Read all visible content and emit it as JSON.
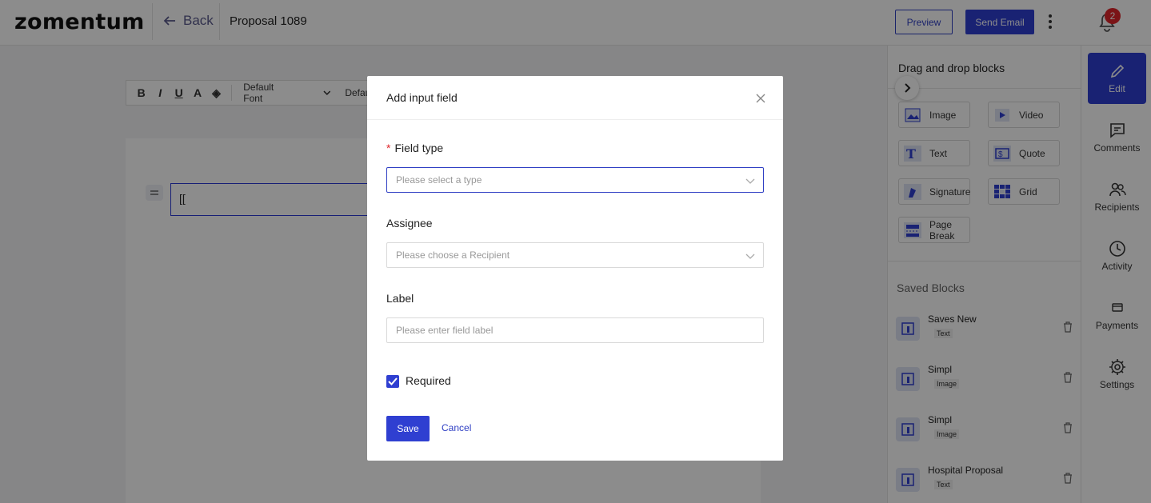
{
  "header": {
    "logo": "zomentum",
    "back_label": "Back",
    "title": "Proposal 1089",
    "preview_label": "Preview",
    "send_email_label": "Send Email",
    "notification_count": "2"
  },
  "editor": {
    "toolbar": {
      "font": "Default Font",
      "size": "Defaul"
    },
    "text_block_content": "[["
  },
  "blocks_panel": {
    "title": "Drag and drop blocks",
    "blocks": [
      {
        "label": "Image",
        "icon": "image-icon"
      },
      {
        "label": "Video",
        "icon": "video-icon"
      },
      {
        "label": "Text",
        "icon": "text-icon"
      },
      {
        "label": "Quote",
        "icon": "quote-icon"
      },
      {
        "label": "Signature",
        "icon": "signature-icon"
      },
      {
        "label": "Grid",
        "icon": "grid-icon"
      },
      {
        "label": "Page Break",
        "icon": "page-break-icon"
      }
    ],
    "saved_title": "Saved Blocks",
    "saved_blocks": [
      {
        "name": "Saves New",
        "type": "Text"
      },
      {
        "name": "Simpl",
        "type": "Image"
      },
      {
        "name": "Simpl",
        "type": "Image"
      },
      {
        "name": "Hospital Proposal",
        "type": "Text"
      }
    ]
  },
  "side_nav": {
    "items": [
      {
        "label": "Edit",
        "icon": "pencil-icon",
        "active": true
      },
      {
        "label": "Comments",
        "icon": "comment-icon"
      },
      {
        "label": "Recipients",
        "icon": "users-icon"
      },
      {
        "label": "Activity",
        "icon": "clock-icon"
      },
      {
        "label": "Payments",
        "icon": "card-icon"
      },
      {
        "label": "Settings",
        "icon": "gear-icon"
      }
    ]
  },
  "modal": {
    "title": "Add input field",
    "field_type_label": "Field type",
    "field_type_placeholder": "Please select a type",
    "assignee_label": "Assignee",
    "assignee_placeholder": "Please choose a Recipient",
    "label_label": "Label",
    "label_placeholder": "Please enter field label",
    "required_label": "Required",
    "required_checked": true,
    "save_label": "Save",
    "cancel_label": "Cancel"
  },
  "colors": {
    "accent": "#2f3fd1",
    "badge": "#e0262b",
    "overlay": "rgba(0,0,0,0.45)"
  }
}
